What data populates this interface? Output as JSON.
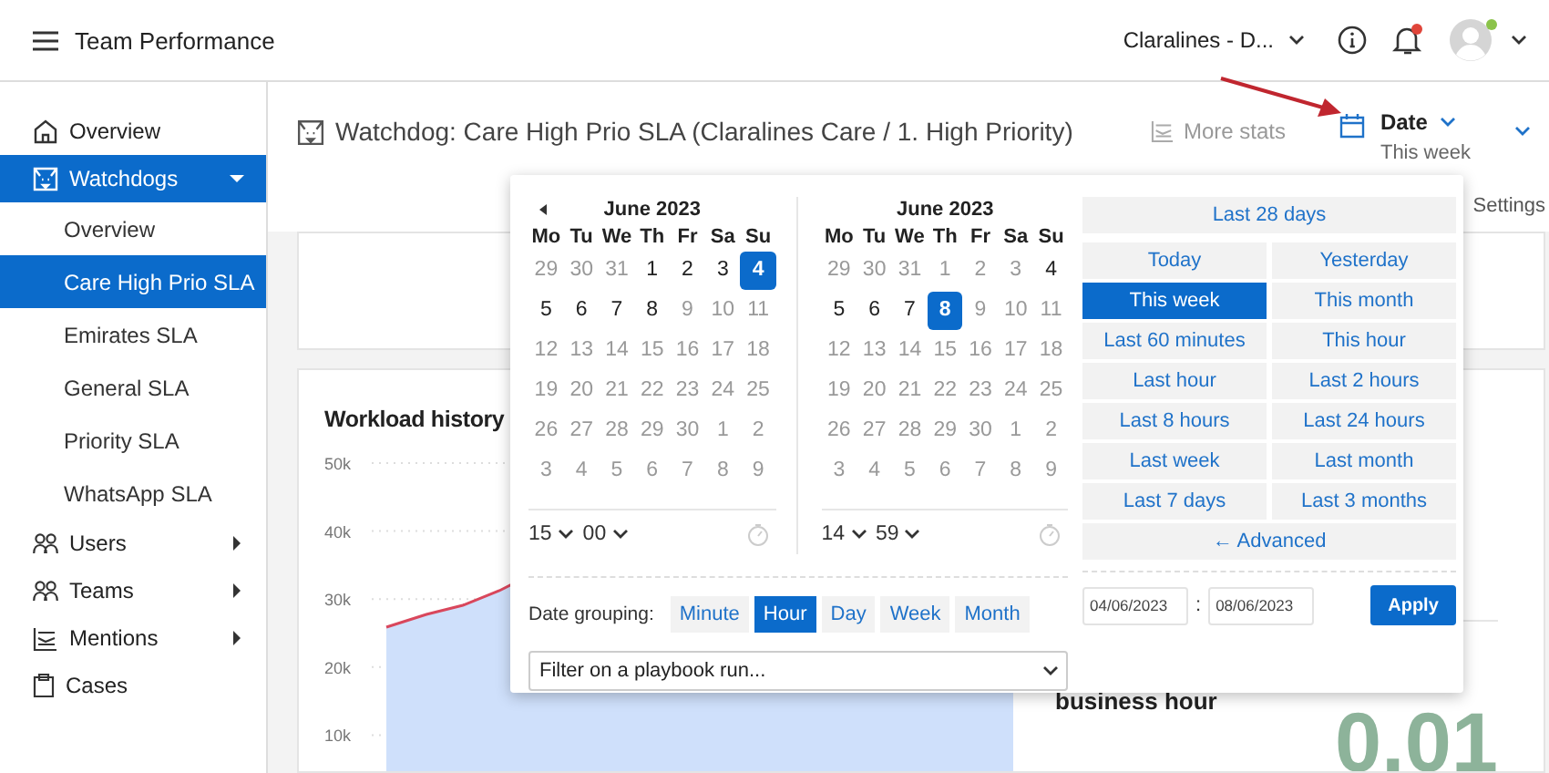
{
  "app": {
    "title": "Team Performance"
  },
  "account": {
    "name": "Claralines - D...",
    "notifications_unread": true,
    "online": true
  },
  "sidebar": {
    "items": [
      {
        "label": "Overview",
        "kind": "link",
        "selected": false
      },
      {
        "label": "Watchdogs",
        "kind": "group",
        "selected": true,
        "expanded": true,
        "children": [
          {
            "label": "Overview",
            "selected": false
          },
          {
            "label": "Care High Prio SLA",
            "selected": true
          },
          {
            "label": "Emirates SLA",
            "selected": false
          },
          {
            "label": "General SLA",
            "selected": false
          },
          {
            "label": "Priority SLA",
            "selected": false
          },
          {
            "label": "WhatsApp SLA",
            "selected": false
          }
        ]
      },
      {
        "label": "Users",
        "kind": "group",
        "selected": false,
        "expanded": false
      },
      {
        "label": "Teams",
        "kind": "group",
        "selected": false,
        "expanded": false
      },
      {
        "label": "Mentions",
        "kind": "group",
        "selected": false,
        "expanded": false
      },
      {
        "label": "Cases",
        "kind": "link",
        "selected": false
      }
    ]
  },
  "page_header": {
    "title": "Watchdog: Care High Prio SLA (Claralines Care / 1. High Priority)",
    "more_stats": "More stats",
    "date": {
      "label": "Date",
      "value": "This week"
    },
    "tabs": [
      {
        "label": "Settings",
        "selected": false
      }
    ]
  },
  "workload": {
    "title": "Workload history",
    "y_labels": [
      "50k",
      "40k",
      "30k",
      "20k",
      "10k"
    ]
  },
  "metrics": [
    {
      "label": "business hour",
      "value": "0.01"
    }
  ],
  "date_picker": {
    "calendars": [
      {
        "month": "June 2023",
        "has_previous": true,
        "weekdays": [
          "Mo",
          "Tu",
          "We",
          "Th",
          "Fr",
          "Sa",
          "Su"
        ],
        "time": {
          "hour": "15",
          "minute": "00"
        },
        "weeks": [
          [
            {
              "d": "29",
              "muted": true,
              "selected": false
            },
            {
              "d": "30",
              "muted": true,
              "selected": false
            },
            {
              "d": "31",
              "muted": true,
              "selected": false
            },
            {
              "d": "1",
              "muted": false,
              "selected": false
            },
            {
              "d": "2",
              "muted": false,
              "selected": false
            },
            {
              "d": "3",
              "muted": false,
              "selected": false
            },
            {
              "d": "4",
              "muted": false,
              "selected": true
            }
          ],
          [
            {
              "d": "5",
              "muted": false,
              "selected": false
            },
            {
              "d": "6",
              "muted": false,
              "selected": false
            },
            {
              "d": "7",
              "muted": false,
              "selected": false
            },
            {
              "d": "8",
              "muted": false,
              "selected": false
            },
            {
              "d": "9",
              "muted": true,
              "selected": false
            },
            {
              "d": "10",
              "muted": true,
              "selected": false
            },
            {
              "d": "11",
              "muted": true,
              "selected": false
            }
          ],
          [
            {
              "d": "12",
              "muted": true,
              "selected": false
            },
            {
              "d": "13",
              "muted": true,
              "selected": false
            },
            {
              "d": "14",
              "muted": true,
              "selected": false
            },
            {
              "d": "15",
              "muted": true,
              "selected": false
            },
            {
              "d": "16",
              "muted": true,
              "selected": false
            },
            {
              "d": "17",
              "muted": true,
              "selected": false
            },
            {
              "d": "18",
              "muted": true,
              "selected": false
            }
          ],
          [
            {
              "d": "19",
              "muted": true,
              "selected": false
            },
            {
              "d": "20",
              "muted": true,
              "selected": false
            },
            {
              "d": "21",
              "muted": true,
              "selected": false
            },
            {
              "d": "22",
              "muted": true,
              "selected": false
            },
            {
              "d": "23",
              "muted": true,
              "selected": false
            },
            {
              "d": "24",
              "muted": true,
              "selected": false
            },
            {
              "d": "25",
              "muted": true,
              "selected": false
            }
          ],
          [
            {
              "d": "26",
              "muted": true,
              "selected": false
            },
            {
              "d": "27",
              "muted": true,
              "selected": false
            },
            {
              "d": "28",
              "muted": true,
              "selected": false
            },
            {
              "d": "29",
              "muted": true,
              "selected": false
            },
            {
              "d": "30",
              "muted": true,
              "selected": false
            },
            {
              "d": "1",
              "muted": true,
              "selected": false
            },
            {
              "d": "2",
              "muted": true,
              "selected": false
            }
          ],
          [
            {
              "d": "3",
              "muted": true,
              "selected": false
            },
            {
              "d": "4",
              "muted": true,
              "selected": false
            },
            {
              "d": "5",
              "muted": true,
              "selected": false
            },
            {
              "d": "6",
              "muted": true,
              "selected": false
            },
            {
              "d": "7",
              "muted": true,
              "selected": false
            },
            {
              "d": "8",
              "muted": true,
              "selected": false
            },
            {
              "d": "9",
              "muted": true,
              "selected": false
            }
          ]
        ]
      },
      {
        "month": "June 2023",
        "has_previous": false,
        "weekdays": [
          "Mo",
          "Tu",
          "We",
          "Th",
          "Fr",
          "Sa",
          "Su"
        ],
        "time": {
          "hour": "14",
          "minute": "59"
        },
        "weeks": [
          [
            {
              "d": "29",
              "muted": true,
              "selected": false
            },
            {
              "d": "30",
              "muted": true,
              "selected": false
            },
            {
              "d": "31",
              "muted": true,
              "selected": false
            },
            {
              "d": "1",
              "muted": true,
              "selected": false
            },
            {
              "d": "2",
              "muted": true,
              "selected": false
            },
            {
              "d": "3",
              "muted": true,
              "selected": false
            },
            {
              "d": "4",
              "muted": false,
              "selected": false
            }
          ],
          [
            {
              "d": "5",
              "muted": false,
              "selected": false
            },
            {
              "d": "6",
              "muted": false,
              "selected": false
            },
            {
              "d": "7",
              "muted": false,
              "selected": false
            },
            {
              "d": "8",
              "muted": false,
              "selected": true
            },
            {
              "d": "9",
              "muted": true,
              "selected": false
            },
            {
              "d": "10",
              "muted": true,
              "selected": false
            },
            {
              "d": "11",
              "muted": true,
              "selected": false
            }
          ],
          [
            {
              "d": "12",
              "muted": true,
              "selected": false
            },
            {
              "d": "13",
              "muted": true,
              "selected": false
            },
            {
              "d": "14",
              "muted": true,
              "selected": false
            },
            {
              "d": "15",
              "muted": true,
              "selected": false
            },
            {
              "d": "16",
              "muted": true,
              "selected": false
            },
            {
              "d": "17",
              "muted": true,
              "selected": false
            },
            {
              "d": "18",
              "muted": true,
              "selected": false
            }
          ],
          [
            {
              "d": "19",
              "muted": true,
              "selected": false
            },
            {
              "d": "20",
              "muted": true,
              "selected": false
            },
            {
              "d": "21",
              "muted": true,
              "selected": false
            },
            {
              "d": "22",
              "muted": true,
              "selected": false
            },
            {
              "d": "23",
              "muted": true,
              "selected": false
            },
            {
              "d": "24",
              "muted": true,
              "selected": false
            },
            {
              "d": "25",
              "muted": true,
              "selected": false
            }
          ],
          [
            {
              "d": "26",
              "muted": true,
              "selected": false
            },
            {
              "d": "27",
              "muted": true,
              "selected": false
            },
            {
              "d": "28",
              "muted": true,
              "selected": false
            },
            {
              "d": "29",
              "muted": true,
              "selected": false
            },
            {
              "d": "30",
              "muted": true,
              "selected": false
            },
            {
              "d": "1",
              "muted": true,
              "selected": false
            },
            {
              "d": "2",
              "muted": true,
              "selected": false
            }
          ],
          [
            {
              "d": "3",
              "muted": true,
              "selected": false
            },
            {
              "d": "4",
              "muted": true,
              "selected": false
            },
            {
              "d": "5",
              "muted": true,
              "selected": false
            },
            {
              "d": "6",
              "muted": true,
              "selected": false
            },
            {
              "d": "7",
              "muted": true,
              "selected": false
            },
            {
              "d": "8",
              "muted": true,
              "selected": false
            },
            {
              "d": "9",
              "muted": true,
              "selected": false
            }
          ]
        ]
      }
    ],
    "grouping": {
      "label": "Date grouping:",
      "options": [
        {
          "label": "Minute",
          "selected": false
        },
        {
          "label": "Hour",
          "selected": true
        },
        {
          "label": "Day",
          "selected": false
        },
        {
          "label": "Week",
          "selected": false
        },
        {
          "label": "Month",
          "selected": false
        }
      ]
    },
    "filter": {
      "value": "Filter on a playbook run..."
    },
    "presets": [
      {
        "label": "Last 28 days",
        "kind": "wide",
        "selected": false
      },
      {
        "label": "Today",
        "kind": "half",
        "selected": false
      },
      {
        "label": "Yesterday",
        "kind": "half",
        "selected": false
      },
      {
        "label": "This week",
        "kind": "half",
        "selected": true
      },
      {
        "label": "This month",
        "kind": "half",
        "selected": false
      },
      {
        "label": "Last 60 minutes",
        "kind": "half",
        "selected": false
      },
      {
        "label": "This hour",
        "kind": "half",
        "selected": false
      },
      {
        "label": "Last hour",
        "kind": "half",
        "selected": false
      },
      {
        "label": "Last 2 hours",
        "kind": "half",
        "selected": false
      },
      {
        "label": "Last 8 hours",
        "kind": "half",
        "selected": false
      },
      {
        "label": "Last 24 hours",
        "kind": "half",
        "selected": false
      },
      {
        "label": "Last week",
        "kind": "half",
        "selected": false
      },
      {
        "label": "Last month",
        "kind": "half",
        "selected": false
      },
      {
        "label": "Last 7 days",
        "kind": "half",
        "selected": false
      },
      {
        "label": "Last 3 months",
        "kind": "half",
        "selected": false
      },
      {
        "label": "← Advanced",
        "kind": "wide",
        "selected": false
      }
    ],
    "range": {
      "from": "04/06/2023",
      "separator": ":",
      "to": "08/06/2023"
    },
    "apply": "Apply"
  }
}
